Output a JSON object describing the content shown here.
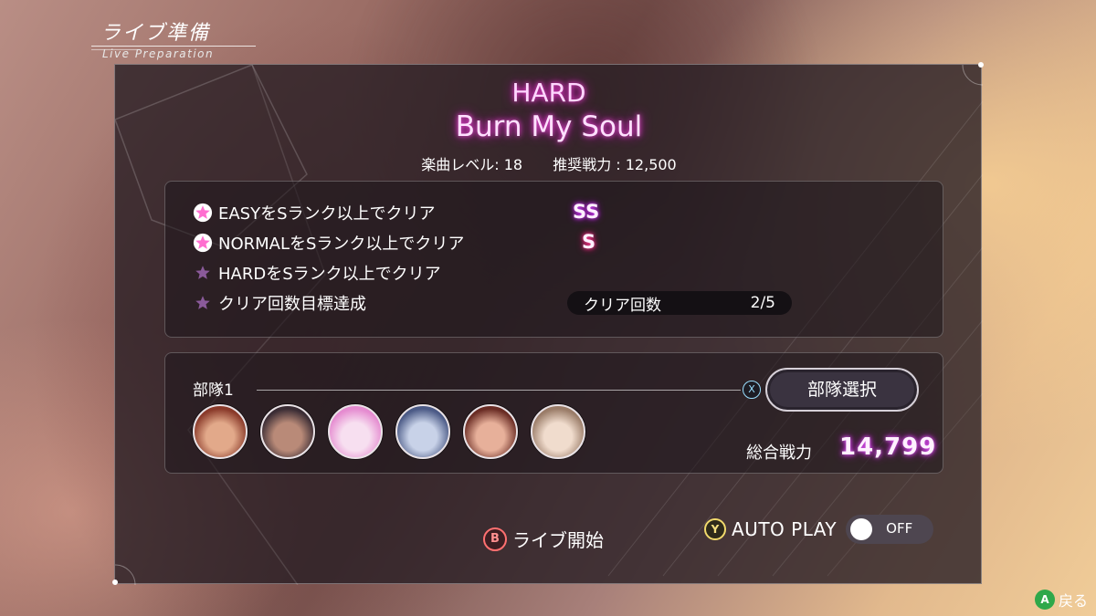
{
  "header": {
    "title": "ライブ準備",
    "subtitle": "Live Preparation"
  },
  "song": {
    "difficulty": "HARD",
    "title": "Burn My Soul",
    "level_text": "楽曲レベル: 18",
    "recommended_text": "推奨戦力 : 12,500"
  },
  "missions": [
    {
      "label": "EASYをSランク以上でクリア",
      "achieved": true,
      "result": "SS"
    },
    {
      "label": "NORMALをSランク以上でクリア",
      "achieved": true,
      "result": "S"
    },
    {
      "label": "HARDをSランク以上でクリア",
      "achieved": false
    },
    {
      "label": "クリア回数目標達成",
      "achieved": false
    }
  ],
  "clear_count": {
    "label": "クリア回数",
    "value": "2/5"
  },
  "team": {
    "name": "部隊1",
    "select_hint": "X",
    "select_label": "部隊選択",
    "power_label": "総合戦力",
    "power_value": "14,799",
    "members": [
      {
        "colors": [
          "#8a3a2a",
          "#e2a98a"
        ]
      },
      {
        "colors": [
          "#3a2c34",
          "#b98a78"
        ]
      },
      {
        "colors": [
          "#e58bd0",
          "#f7dff0"
        ]
      },
      {
        "colors": [
          "#4b5a86",
          "#c8d2e8"
        ]
      },
      {
        "colors": [
          "#6a2c24",
          "#e7b09a"
        ]
      },
      {
        "colors": [
          "#9a7c68",
          "#f0dccd"
        ]
      }
    ]
  },
  "actions": {
    "start_button": "B",
    "start_label": "ライブ開始",
    "auto_button": "Y",
    "auto_label": "AUTO PLAY",
    "auto_state": "OFF",
    "back_button": "A",
    "back_label": "戻る"
  },
  "colors": {
    "accent_pink": "#ff5be6",
    "star_on": "#ff6fd0",
    "star_off": "#8a5a9a"
  }
}
